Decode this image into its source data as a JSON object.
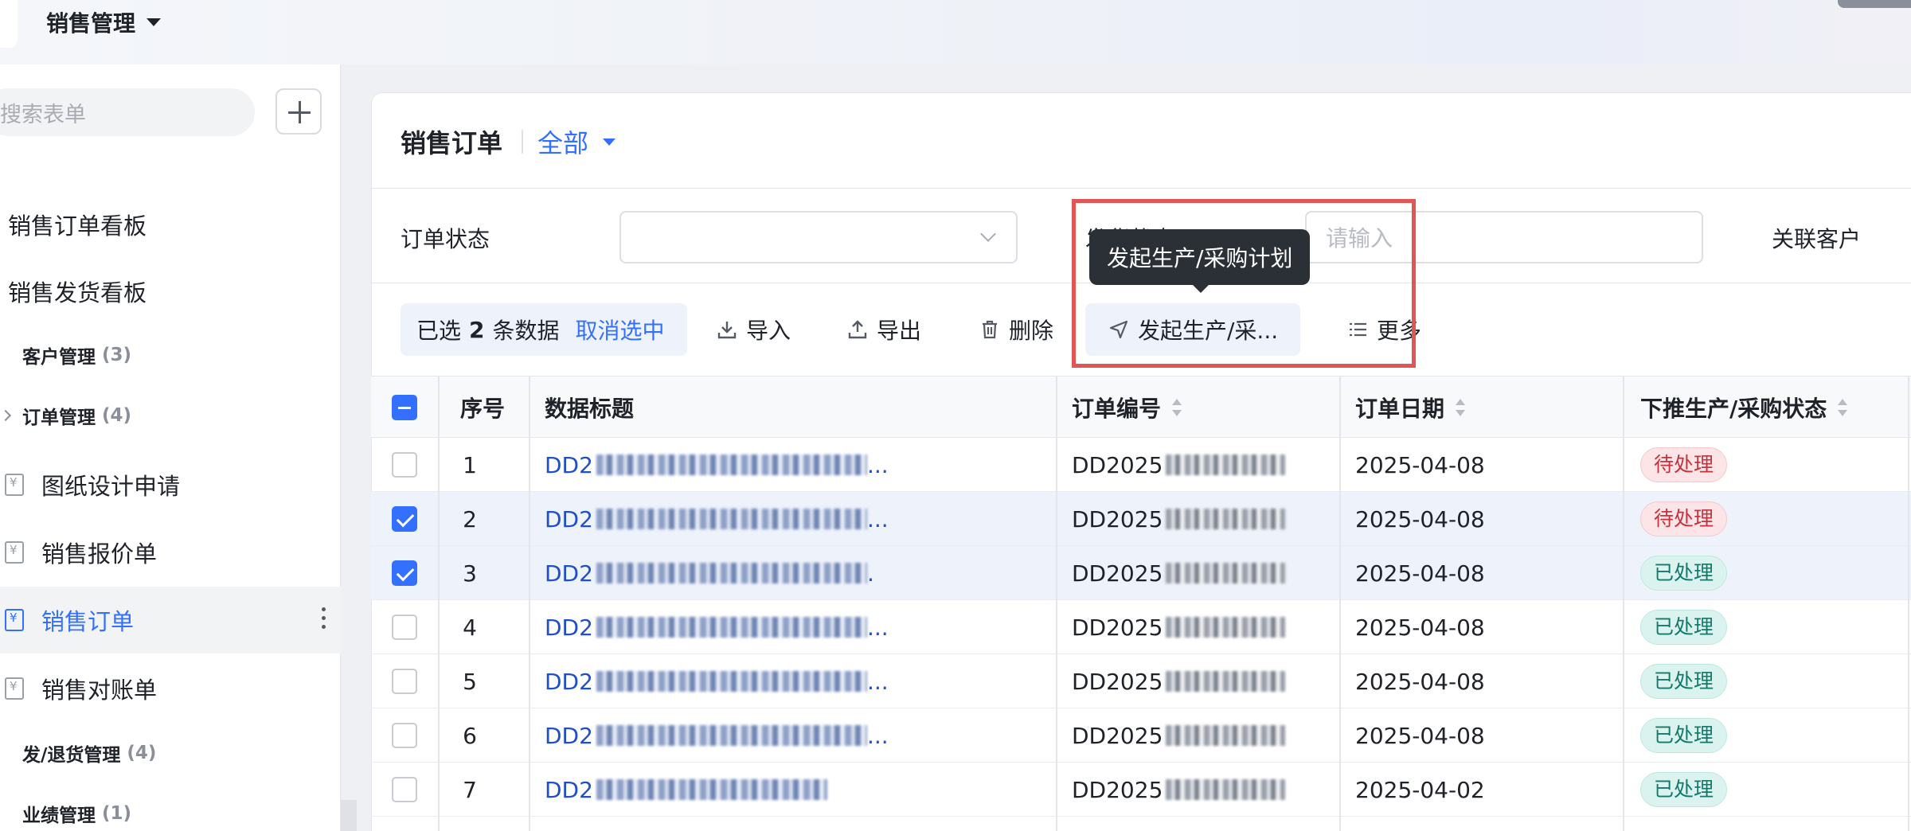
{
  "app": {
    "title": "销售管理"
  },
  "sidebar": {
    "search_placeholder": "搜索表单",
    "items": [
      {
        "label": "销售订单看板"
      },
      {
        "label": "销售发货看板"
      },
      {
        "label": "客户管理",
        "count": "(3)"
      },
      {
        "label": "订单管理",
        "count": "(4)"
      },
      {
        "label": "图纸设计申请"
      },
      {
        "label": "销售报价单"
      },
      {
        "label": "销售订单"
      },
      {
        "label": "销售对账单"
      },
      {
        "label": "发/退货管理",
        "count": "(4)"
      },
      {
        "label": "业绩管理",
        "count": "(1)"
      }
    ]
  },
  "main": {
    "title": "销售订单",
    "view": "全部",
    "filters": {
      "order_status_label": "订单状态",
      "ship_status_label": "发货状态",
      "ship_status_placeholder": "请输入",
      "related_customer_label": "关联客户"
    },
    "toolbar": {
      "selected_prefix": "已选",
      "selected_count": "2",
      "selected_suffix": "条数据",
      "cancel_selection": "取消选中",
      "import": "导入",
      "export": "导出",
      "delete": "删除",
      "launch_plan": "发起生产/采...",
      "more": "更多"
    },
    "tooltip": "发起生产/采购计划",
    "table": {
      "headers": [
        "序号",
        "数据标题",
        "订单编号",
        "订单日期",
        "下推生产/采购状态"
      ],
      "rows": [
        {
          "seq": "1",
          "title": "DD2",
          "title_end": "...",
          "order_no": "DD2025",
          "date": "2025-04-08",
          "status": "待处理",
          "selected": false
        },
        {
          "seq": "2",
          "title": "DD2",
          "title_end": "...",
          "order_no": "DD2025",
          "date": "2025-04-08",
          "status": "待处理",
          "selected": true
        },
        {
          "seq": "3",
          "title": "DD2",
          "title_end": ".",
          "order_no": "DD2025",
          "date": "2025-04-08",
          "status": "已处理",
          "selected": true
        },
        {
          "seq": "4",
          "title": "DD2",
          "title_end": "...",
          "order_no": "DD2025",
          "date": "2025-04-08",
          "status": "已处理",
          "selected": false
        },
        {
          "seq": "5",
          "title": "DD2",
          "title_end": "...",
          "order_no": "DD2025",
          "date": "2025-04-08",
          "status": "已处理",
          "selected": false
        },
        {
          "seq": "6",
          "title": "DD2",
          "title_end": "...",
          "order_no": "DD2025",
          "date": "2025-04-08",
          "status": "已处理",
          "selected": false
        },
        {
          "seq": "7",
          "title": "DD2",
          "title_end": "",
          "order_no": "DD2025",
          "date": "2025-04-02",
          "status": "已处理",
          "selected": false
        }
      ]
    }
  },
  "colors": {
    "accent": "#3370ff",
    "highlight_box": "#e35555",
    "pending": "#c4343e",
    "done": "#137a6b"
  }
}
